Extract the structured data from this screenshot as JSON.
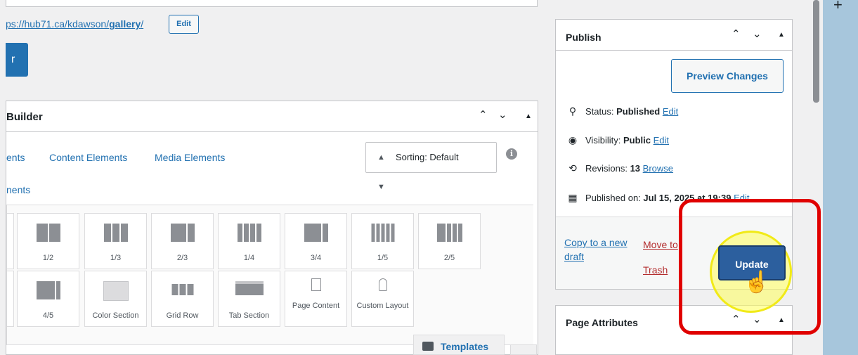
{
  "editor": {
    "permalink_prefix": "ps://hub71.ca/kdawson/",
    "permalink_slug": "gallery",
    "permalink_suffix": "/",
    "edit_label": "Edit",
    "primary_btn": "r"
  },
  "builder": {
    "title": "Builder",
    "tabs": [
      "ents",
      "Content Elements",
      "Media Elements"
    ],
    "second_row_tab": "nents",
    "sorting": "Sorting: Default",
    "info_glyph": "i",
    "row1": [
      "1/2",
      "1/3",
      "2/3",
      "1/4",
      "3/4",
      "1/5",
      "2/5"
    ],
    "row2": [
      "4/5",
      "Color Section",
      "Grid Row",
      "Tab Section",
      "Page Content",
      "Custom Layout"
    ],
    "templates_label": "Templates"
  },
  "publish": {
    "title": "Publish",
    "preview_label": "Preview Changes",
    "status_label": "Status: ",
    "status_value": "Published",
    "visibility_label": "Visibility: ",
    "visibility_value": "Public",
    "revisions_label": "Revisions: ",
    "revisions_value": "13",
    "browse_label": "Browse",
    "published_label": "Published on: ",
    "published_value": "Jul 15, 2025 at 19:39",
    "edit_link": "Edit",
    "copy_draft": "Copy to a new draft",
    "move_trash": "Move to Trash",
    "update_label": "Update"
  },
  "page_attributes": {
    "title": "Page Attributes"
  },
  "controls": {
    "up": "⌃",
    "down": "⌄",
    "toggle": "▲",
    "plus": "+"
  },
  "colors": {
    "accent": "#2271b1",
    "highlight_red": "#e00000",
    "highlight_yellow": "#f1ea18"
  }
}
